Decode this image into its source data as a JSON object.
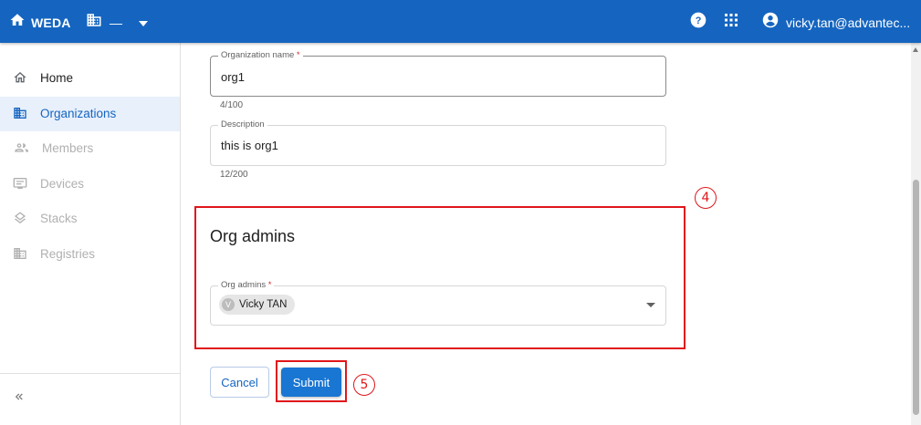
{
  "topbar": {
    "brand": "WEDA",
    "org_placeholder": "—",
    "user_email": "vicky.tan@advantec...",
    "icons": [
      "home-icon",
      "building-icon",
      "caret-down-icon",
      "help-icon",
      "apps-grid-icon",
      "account-icon"
    ]
  },
  "sidebar": {
    "items": [
      {
        "label": "Home",
        "icon": "home-outline-icon",
        "state": "normal"
      },
      {
        "label": "Organizations",
        "icon": "building-icon",
        "state": "active"
      },
      {
        "label": "Members",
        "icon": "people-icon",
        "state": "disabled"
      },
      {
        "label": "Devices",
        "icon": "monitor-icon",
        "state": "disabled"
      },
      {
        "label": "Stacks",
        "icon": "layers-icon",
        "state": "disabled"
      },
      {
        "label": "Registries",
        "icon": "building-icon",
        "state": "disabled"
      }
    ],
    "collapse_icon": "double-chevron-left-icon"
  },
  "form": {
    "org_name": {
      "label": "Organization name",
      "required_mark": "*",
      "value": "org1",
      "counter": "4/100"
    },
    "description": {
      "label": "Description",
      "value": "this is org1",
      "counter": "12/200"
    },
    "org_admins_section": {
      "title": "Org admins",
      "field_label": "Org admins",
      "required_mark": "*",
      "chip": {
        "avatar_letter": "V",
        "label": "Vicky TAN"
      }
    },
    "cancel_label": "Cancel",
    "submit_label": "Submit"
  },
  "annotations": {
    "step4": "4",
    "step5": "5",
    "color": "#e0161b"
  },
  "colors": {
    "primary": "#1565c0",
    "active_bg": "#e8f0fb",
    "button": "#1976d2"
  }
}
